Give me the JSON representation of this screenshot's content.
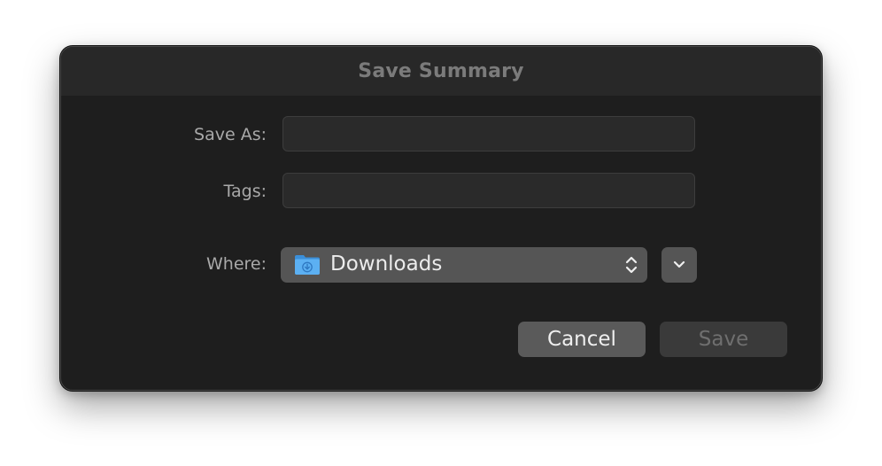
{
  "dialog": {
    "title": "Save Summary"
  },
  "form": {
    "save_as": {
      "label": "Save As:",
      "value": "",
      "placeholder": ""
    },
    "tags": {
      "label": "Tags:",
      "value": "",
      "placeholder": ""
    },
    "where": {
      "label": "Where:",
      "selected": "Downloads",
      "icon": "downloads-folder-icon"
    }
  },
  "buttons": {
    "expand_icon": "chevron-down-icon",
    "cancel_label": "Cancel",
    "save_label": "Save"
  },
  "colors": {
    "dialog_background": "#1e1e1e",
    "titlebar_background": "#282828",
    "folder_blue": "#4fa3e8",
    "disabled_text": "#6f6f6f"
  }
}
